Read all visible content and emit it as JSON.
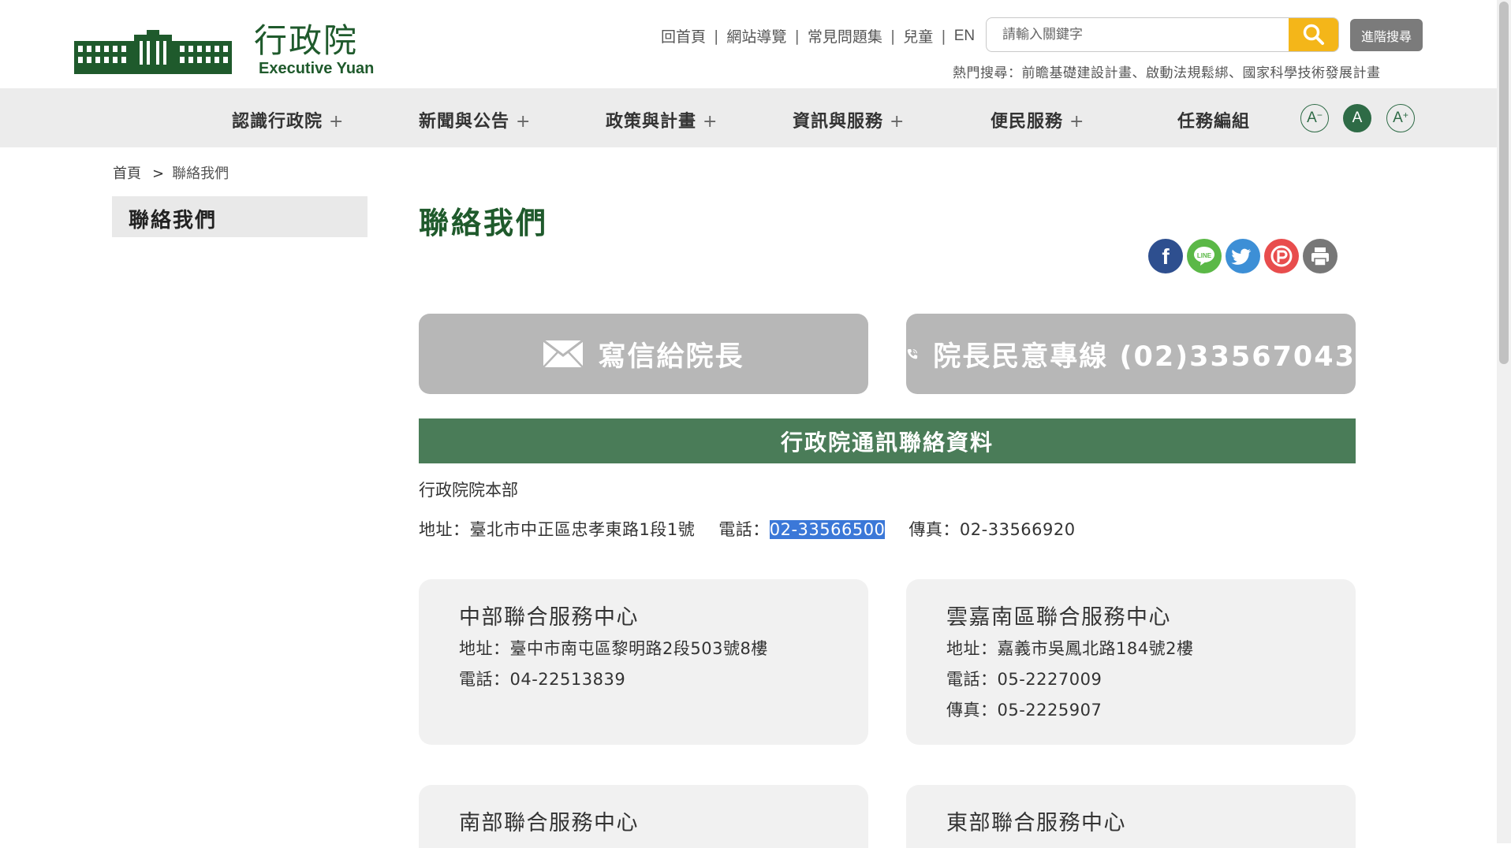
{
  "header": {
    "logo_cn": "行政院",
    "logo_en": "Executive Yuan",
    "top_links": [
      "回首頁",
      "網站導覽",
      "常見問題集",
      "兒童",
      "EN"
    ],
    "separator": "|",
    "search_placeholder": "請輸入關鍵字",
    "advanced_search_label": "進階搜尋",
    "hot_search": "熱門搜尋：前瞻基礎建設計畫、啟動法規鬆綁、國家科學技術發展計畫"
  },
  "nav": {
    "items": [
      {
        "label": "認識行政院",
        "plus": "+"
      },
      {
        "label": "新聞與公告",
        "plus": "+"
      },
      {
        "label": "政策與計畫",
        "plus": "+"
      },
      {
        "label": "資訊與服務",
        "plus": "+"
      },
      {
        "label": "便民服務",
        "plus": "+"
      },
      {
        "label": "任務編組",
        "plus": ""
      }
    ],
    "font_size_buttons": [
      {
        "label": "A",
        "sup": "−"
      },
      {
        "label": "A",
        "sup": ""
      },
      {
        "label": "A",
        "sup": "+"
      }
    ]
  },
  "breadcrumb": {
    "home": "首頁",
    "separator": ">",
    "current": "聯絡我們"
  },
  "sidebar": {
    "item": "聯絡我們"
  },
  "main": {
    "title": "聯絡我們",
    "share_icons": [
      "facebook-icon",
      "line-icon",
      "twitter-icon",
      "plurk-icon",
      "print-icon"
    ],
    "write_letter_label": "寫信給院長",
    "hotline_label": "院長民意專線 (02)33567043",
    "section_title": "行政院通訊聯絡資料",
    "hq": {
      "name": "行政院院本部",
      "address": "地址：臺北市中正區忠孝東路1段1號",
      "phone_prefix": "電話：",
      "phone": "02-33566500",
      "fax": "傳真：02-33566920"
    },
    "centers": [
      {
        "title": "中部聯合服務中心",
        "address": "地址：臺中市南屯區黎明路2段503號8樓",
        "phone": "電話：04-22513839",
        "fax": ""
      },
      {
        "title": "雲嘉南區聯合服務中心",
        "address": "地址：嘉義市吳鳳北路184號2樓",
        "phone": "電話：05-2227009",
        "fax": "傳真：05-2225907"
      },
      {
        "title": "南部聯合服務中心"
      },
      {
        "title": "東部聯合服務中心"
      }
    ]
  },
  "colors": {
    "brand_green": "#1f5a2c",
    "section_green": "#4a7c58",
    "search_yellow": "#f4b619",
    "button_gray": "#b7b7b7",
    "selection_blue": "#3b78d8"
  }
}
